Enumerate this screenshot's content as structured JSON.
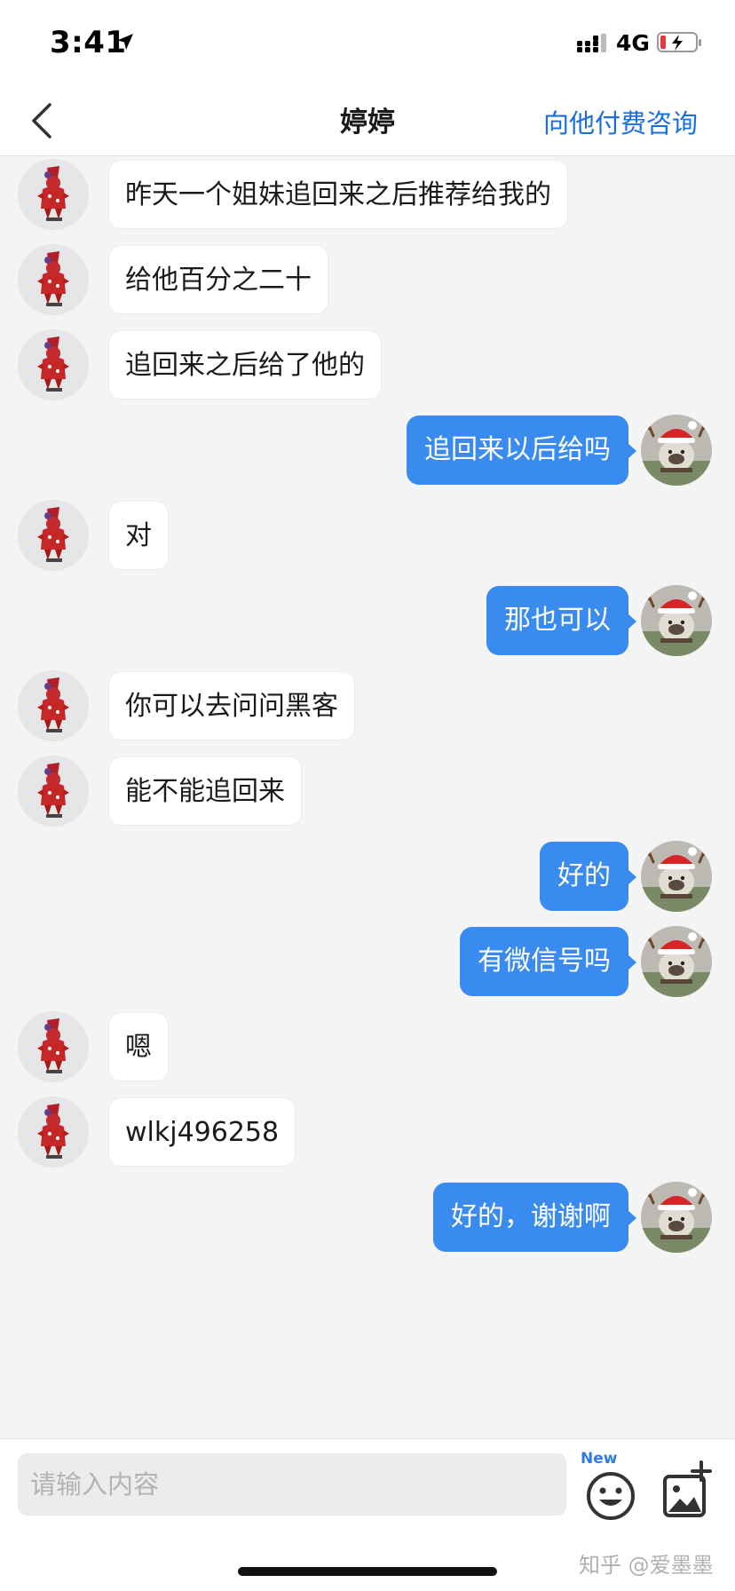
{
  "status_bar": {
    "time": "3:41",
    "network": "4G"
  },
  "nav": {
    "title": "婷婷",
    "action": "向他付费咨询"
  },
  "messages": [
    {
      "side": "left",
      "text": "昨天一个姐妹追回来之后推荐给我的"
    },
    {
      "side": "left",
      "text": "给他百分之二十"
    },
    {
      "side": "left",
      "text": "追回来之后给了他的"
    },
    {
      "side": "right",
      "text": "追回来以后给吗"
    },
    {
      "side": "left",
      "text": "对"
    },
    {
      "side": "right",
      "text": "那也可以"
    },
    {
      "side": "left",
      "text": "你可以去问问黑客"
    },
    {
      "side": "left",
      "text": "能不能追回来"
    },
    {
      "side": "right",
      "text": "好的"
    },
    {
      "side": "right",
      "text": "有微信号吗"
    },
    {
      "side": "left",
      "text": "嗯"
    },
    {
      "side": "left",
      "text": "wlkj496258"
    },
    {
      "side": "right",
      "text": "好的，谢谢啊"
    }
  ],
  "input": {
    "placeholder": "请输入内容",
    "value": ""
  },
  "badge": "New",
  "watermark": "知乎 @爱墨墨",
  "colors": {
    "accent": "#1a6fe0",
    "bubble_self": "#3a8bf0",
    "bubble_other": "#ffffff",
    "background": "#f4f4f5"
  },
  "icons": {
    "back": "chevron-left-icon",
    "emoji": "smiley-icon",
    "image": "add-image-icon"
  }
}
